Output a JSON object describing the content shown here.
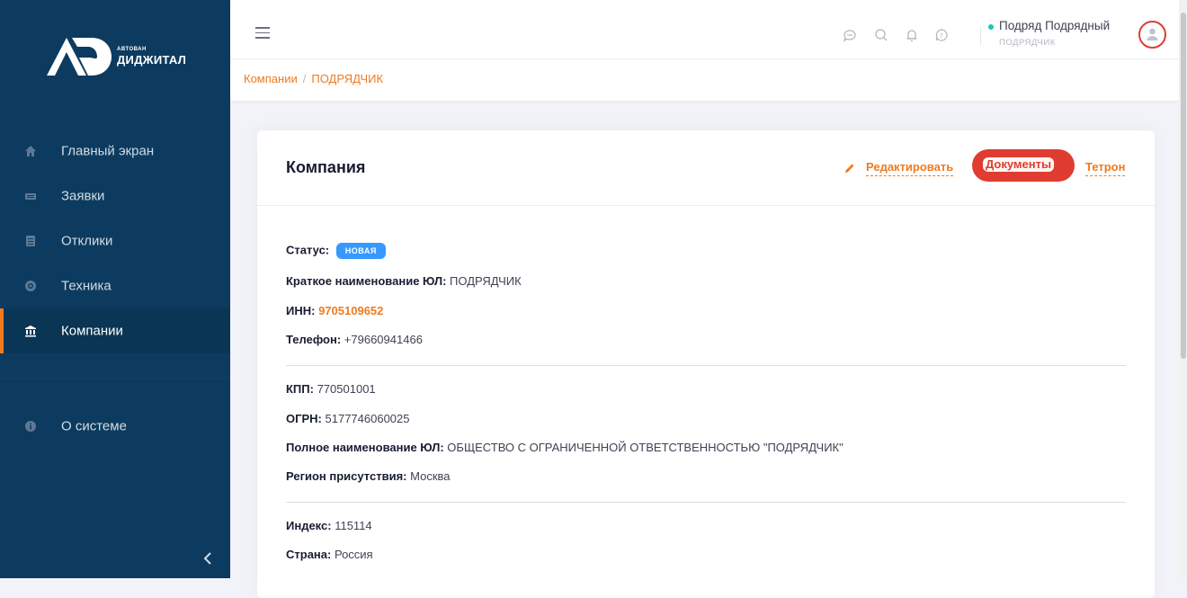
{
  "brand": {
    "small": "АВТОВАН",
    "big": "ДИДЖИТАЛ"
  },
  "sidebar": {
    "items": [
      {
        "label": "Главный экран",
        "icon": "home-icon"
      },
      {
        "label": "Заявки",
        "icon": "ticket-icon"
      },
      {
        "label": "Отклики",
        "icon": "document-icon"
      },
      {
        "label": "Техника",
        "icon": "disc-icon"
      },
      {
        "label": "Компании",
        "icon": "bank-icon",
        "active": true
      }
    ],
    "about": {
      "label": "О системе",
      "icon": "info-icon"
    }
  },
  "breadcrumb": {
    "root": "Компании",
    "separator": "/",
    "current": "ПОДРЯДЧИК"
  },
  "user": {
    "name": "Подряд Подрядный",
    "role": "ПОДРЯДЧИК"
  },
  "card": {
    "title": "Компания",
    "actions": {
      "edit": "Редактировать",
      "documents": "Документы",
      "tetron": "Тетрон"
    },
    "fields": {
      "status": {
        "label": "Статус:",
        "value": "НОВАЯ"
      },
      "short_name": {
        "label": "Краткое наименование ЮЛ:",
        "value": "ПОДРЯДЧИК"
      },
      "inn": {
        "label": "ИНН:",
        "value": "9705109652"
      },
      "phone": {
        "label": "Телефон:",
        "value": "+79660941466"
      },
      "kpp": {
        "label": "КПП:",
        "value": "770501001"
      },
      "ogrn": {
        "label": "ОГРН:",
        "value": "5177746060025"
      },
      "full_name": {
        "label": "Полное наименование ЮЛ:",
        "value": "ОБЩЕСТВО С ОГРАНИЧЕННОЙ ОТВЕТСТВЕННОСТЬЮ \"ПОДРЯДЧИК\""
      },
      "region": {
        "label": "Регион присутствия:",
        "value": "Москва"
      },
      "index": {
        "label": "Индекс:",
        "value": "115114"
      },
      "country": {
        "label": "Страна:",
        "value": "Россия"
      }
    }
  },
  "colors": {
    "sidebar": "#0c3b5f",
    "accent": "#f07a1e",
    "badge": "#3699ff",
    "highlight": "#e03c31"
  }
}
